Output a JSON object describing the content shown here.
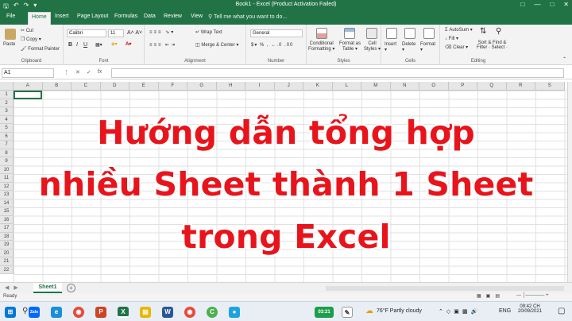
{
  "app": {
    "window_title": "Book1 - Excel (Product Activation Failed)",
    "tell_me": "Tell me what you want to do...",
    "tabs": [
      "File",
      "Home",
      "Insert",
      "Page Layout",
      "Formulas",
      "Data",
      "Review",
      "View"
    ]
  },
  "ribbon": {
    "clipboard": {
      "paste": "Paste",
      "cut": "Cut",
      "copy": "Copy",
      "format_painter": "Format Painter",
      "label": "Clipboard"
    },
    "font": {
      "name": "Calibri",
      "size": "11",
      "label": "Font",
      "bold": "B",
      "italic": "I",
      "underline": "U"
    },
    "alignment": {
      "wrap_text": "Wrap Text",
      "merge_center": "Merge & Center",
      "label": "Alignment"
    },
    "number": {
      "format": "General",
      "label": "Number"
    },
    "styles": {
      "conditional_1": "Conditional",
      "conditional_2": "Formatting",
      "format_as_1": "Format as",
      "format_as_2": "Table",
      "cell_1": "Cell",
      "cell_2": "Styles",
      "label": "Styles"
    },
    "cells": {
      "insert": "Insert",
      "delete": "Delete",
      "format": "Format",
      "label": "Cells"
    },
    "editing": {
      "autosum": "AutoSum",
      "fill": "Fill",
      "clear": "Clear",
      "sort_1": "Sort & Find &",
      "sort_2": "Filter · Select ·",
      "label": "Editing"
    }
  },
  "formula_bar": {
    "name_box": "A1",
    "fx": "fx"
  },
  "grid": {
    "columns": [
      "A",
      "B",
      "C",
      "D",
      "E",
      "F",
      "G",
      "H",
      "I",
      "J",
      "K",
      "L",
      "M",
      "N",
      "O",
      "P",
      "Q",
      "R",
      "S"
    ],
    "rows": [
      "1",
      "2",
      "3",
      "4",
      "5",
      "6",
      "7",
      "8",
      "9",
      "10",
      "11",
      "12",
      "13",
      "14",
      "15",
      "16",
      "17",
      "18",
      "19",
      "20",
      "21",
      "22"
    ]
  },
  "overlay": {
    "line1": "Hướng dẫn tổng hợp",
    "line2": "nhiều Sheet thành 1 Sheet",
    "line3": "trong Excel",
    "color": "#e8141c"
  },
  "sheets": {
    "active": "Sheet1"
  },
  "status": {
    "ready": "Ready"
  },
  "taskbar": {
    "weather": "76°F  Partly cloudy",
    "lang": "ENG",
    "time": "09:42 CH",
    "date": "20/09/2021",
    "timer": "03:21",
    "zalo": "Zalo"
  },
  "colors": {
    "excel_green": "#217346"
  }
}
